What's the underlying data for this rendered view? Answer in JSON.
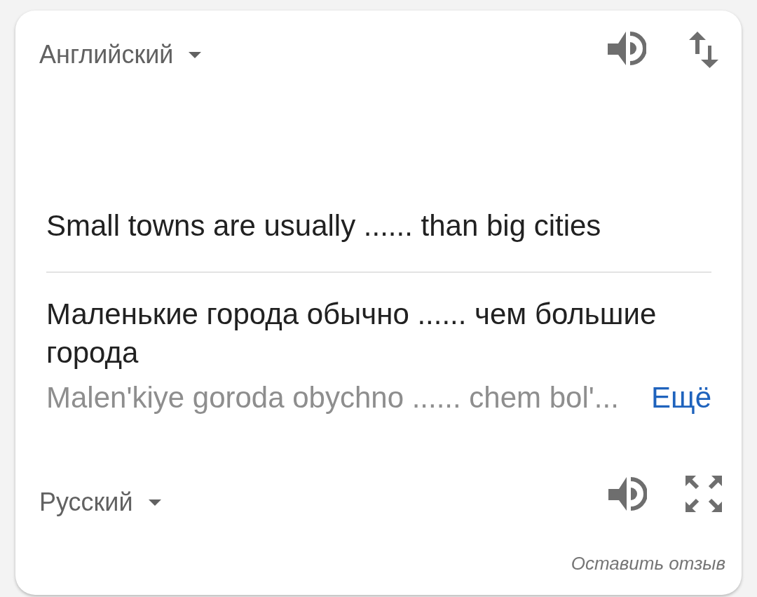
{
  "source": {
    "language": "Английский",
    "text": "Small towns are usually ...... than big cities"
  },
  "translation": {
    "text": "Маленькие города обычно ...... чем большие города",
    "transliteration": "Malen'kiye goroda obychno ...... chem bol'...",
    "more_link": "Ещё"
  },
  "target": {
    "language": "Русский"
  },
  "feedback_link": "Оставить отзыв"
}
